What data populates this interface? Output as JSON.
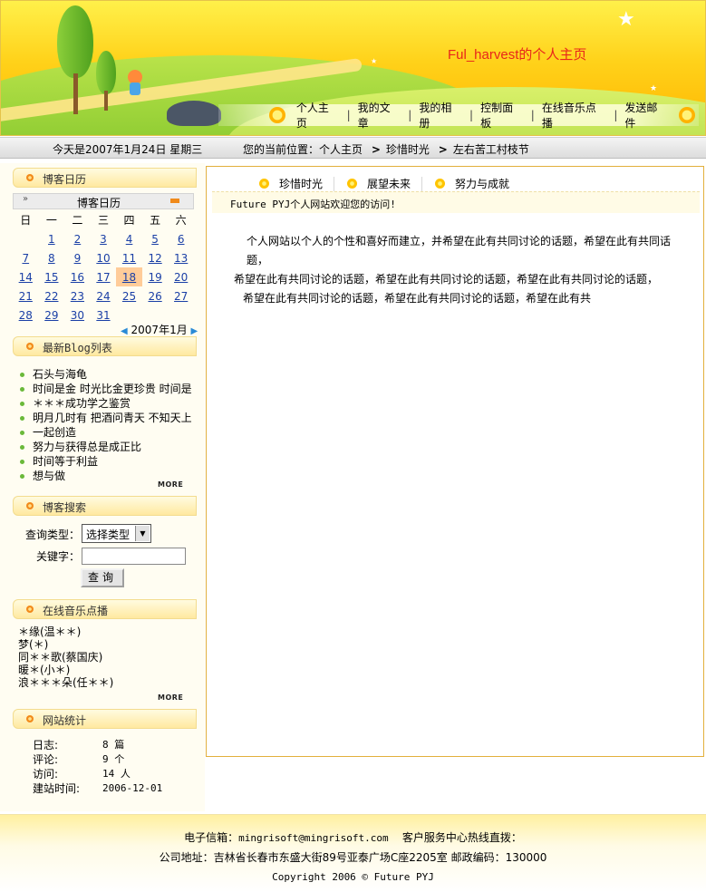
{
  "header": {
    "site_title": "Ful_harvest的个人主页",
    "nav": [
      "个人主页",
      "我的文章",
      "我的相册",
      "控制面板",
      "在线音乐点播",
      "发送邮件"
    ],
    "accent_color": "#ffc400",
    "title_color": "#e8261a"
  },
  "datebar": {
    "today": "今天是2007年1月24日 星期三",
    "location_label": "您的当前位置：个人主页",
    "crumb_1": "珍惜时光",
    "crumb_2": "左右苦工村枝节"
  },
  "sidebar": {
    "calendar": {
      "heading": "博客日历",
      "title": "博客日历",
      "prev_icon": "»",
      "weekdays": [
        "日",
        "一",
        "二",
        "三",
        "四",
        "五",
        "六"
      ],
      "weeks": [
        [
          "",
          "1",
          "2",
          "3",
          "4",
          "5",
          "6"
        ],
        [
          "7",
          "8",
          "9",
          "10",
          "11",
          "12",
          "13"
        ],
        [
          "14",
          "15",
          "16",
          "17",
          "18",
          "19",
          "20"
        ],
        [
          "21",
          "22",
          "23",
          "24",
          "25",
          "26",
          "27"
        ],
        [
          "28",
          "29",
          "30",
          "31",
          "",
          "",
          ""
        ]
      ],
      "highlight_day": "18",
      "month_label": "2007年1月"
    },
    "blog": {
      "heading": "最新Blog列表",
      "items": [
        "石头与海龟",
        "时间是金 时光比金更珍贵 时间是",
        "＊＊＊成功学之鉴赏",
        "明月几时有 把酒问青天 不知天上",
        "一起创造",
        "努力与获得总是成正比",
        "时间等于利益",
        "想与做"
      ],
      "more": "MORE"
    },
    "search": {
      "heading": "博客搜索",
      "type_label": "查询类型：",
      "select_value": "选择类型",
      "keyword_label": "关键字：",
      "keyword_value": "",
      "button": "查询"
    },
    "music": {
      "heading": "在线音乐点播",
      "items": [
        "＊缘(温＊＊)",
        "梦(＊)",
        "同＊＊歌(蔡国庆)",
        "暖＊(小＊)",
        "浪＊＊＊朵(任＊＊)"
      ],
      "more": "MORE"
    },
    "stats": {
      "heading": "网站统计",
      "rows": [
        {
          "k": "日志:",
          "v": "8 篇"
        },
        {
          "k": "评论:",
          "v": "9 个"
        },
        {
          "k": "访问:",
          "v": "14 人"
        },
        {
          "k": "建站时间:",
          "v": "2006-12-01"
        }
      ]
    }
  },
  "main": {
    "tabs": [
      "珍惜时光",
      "展望未来",
      "努力与成就"
    ],
    "welcome": "Future PYJ个人网站欢迎您的访问!",
    "intro_lines": [
      "个人网站以个人的个性和喜好而建立，并希望在此有共同讨论的话题，希望在此有共同话题，",
      "希望在此有共同讨论的话题，希望在此有共同讨论的话题，希望在此有共同讨论的话题，",
      "希望在此有共同讨论的话题，希望在此有共同讨论的话题，希望在此有共"
    ]
  },
  "footer": {
    "email_label": "电子信箱：",
    "email": "mingrisoft@mingrisoft.com",
    "hotline": "客户服务中心热线直拨：",
    "address": "公司地址：吉林省长春市东盛大街89号亚泰广场C座2205室  邮政编码：130000",
    "copyright": "Copyright 2006 © Future PYJ"
  }
}
